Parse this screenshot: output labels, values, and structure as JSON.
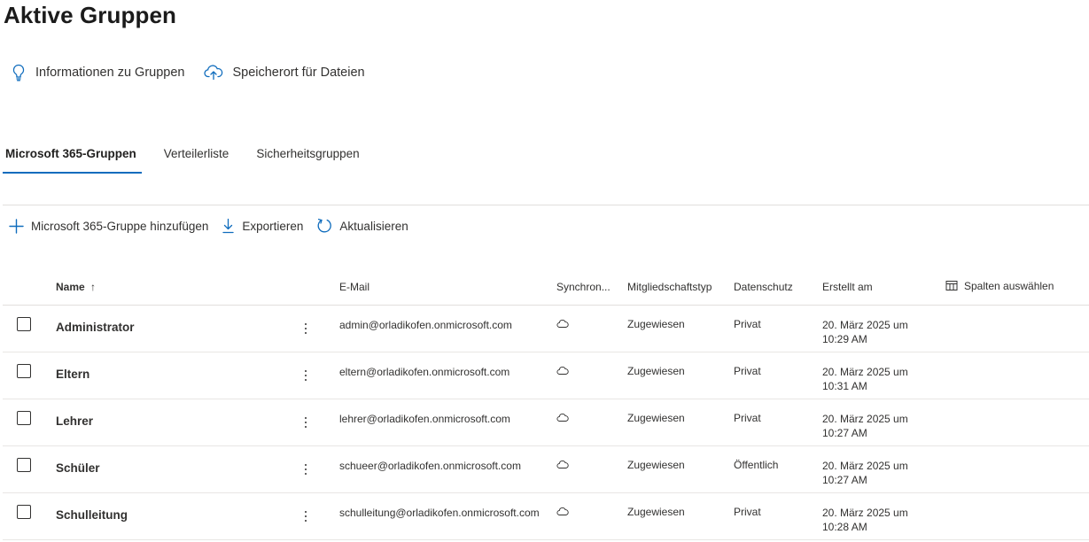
{
  "page_title": "Aktive Gruppen",
  "info_links": [
    {
      "label": "Informationen zu Gruppen",
      "icon": "lightbulb-icon"
    },
    {
      "label": "Speicherort für Dateien",
      "icon": "cloud-upload-icon"
    }
  ],
  "tabs": [
    {
      "label": "Microsoft 365-Gruppen",
      "active": true
    },
    {
      "label": "Verteilerliste",
      "active": false
    },
    {
      "label": "Sicherheitsgruppen",
      "active": false
    }
  ],
  "toolbar": {
    "add_label": "Microsoft 365-Gruppe hinzufügen",
    "export_label": "Exportieren",
    "refresh_label": "Aktualisieren"
  },
  "table": {
    "columns": {
      "name": "Name",
      "email": "E-Mail",
      "sync": "Synchron...",
      "membership": "Mitgliedschaftstyp",
      "privacy": "Datenschutz",
      "created": "Erstellt am",
      "choose_columns": "Spalten auswählen"
    },
    "sort_indicator": "↑",
    "rows": [
      {
        "name": "Administrator",
        "email": "admin@orladikofen.onmicrosoft.com",
        "sync_icon": "cloud-icon",
        "membership": "Zugewiesen",
        "privacy": "Privat",
        "created": "20. März 2025 um 10:29 AM"
      },
      {
        "name": "Eltern",
        "email": "eltern@orladikofen.onmicrosoft.com",
        "sync_icon": "cloud-icon",
        "membership": "Zugewiesen",
        "privacy": "Privat",
        "created": "20. März 2025 um 10:31 AM"
      },
      {
        "name": "Lehrer",
        "email": "lehrer@orladikofen.onmicrosoft.com",
        "sync_icon": "cloud-icon",
        "membership": "Zugewiesen",
        "privacy": "Privat",
        "created": "20. März 2025 um 10:27 AM"
      },
      {
        "name": "Schüler",
        "email": "schueer@orladikofen.onmicrosoft.com",
        "sync_icon": "cloud-icon",
        "membership": "Zugewiesen",
        "privacy": "Öffentlich",
        "created": "20. März 2025 um 10:27 AM"
      },
      {
        "name": "Schulleitung",
        "email": "schulleitung@orladikofen.onmicrosoft.com",
        "sync_icon": "cloud-icon",
        "membership": "Zugewiesen",
        "privacy": "Privat",
        "created": "20. März 2025 um 10:28 AM"
      }
    ]
  },
  "colors": {
    "accent": "#0f6cbd",
    "text": "#323130",
    "divider": "#e1dfdd"
  }
}
